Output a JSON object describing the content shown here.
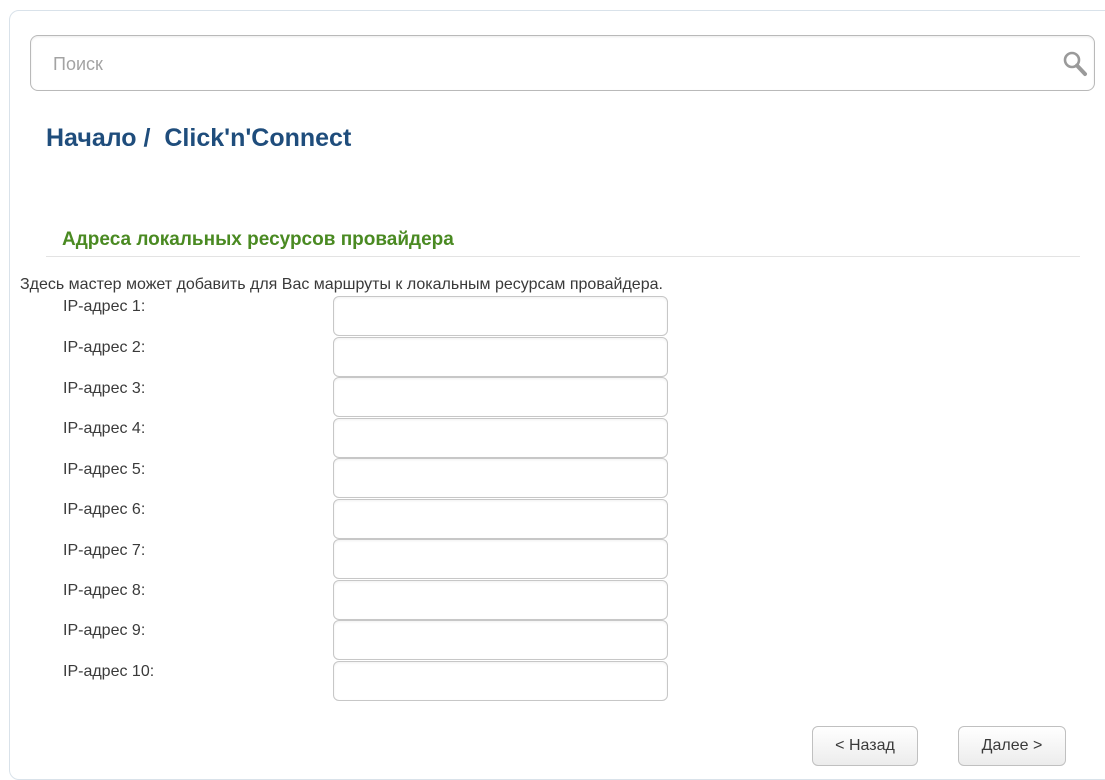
{
  "search": {
    "placeholder": "Поиск",
    "value": "",
    "icon": "search-icon"
  },
  "breadcrumb": {
    "root": "Начало",
    "separator": " /  ",
    "current": "Click'n'Connect"
  },
  "section": {
    "title": "Адреса локальных ресурсов провайдера",
    "description": "Здесь мастер может добавить для Вас маршруты к локальным ресурсам провайдера."
  },
  "fields": [
    {
      "label": "IP-адрес 1:",
      "value": ""
    },
    {
      "label": "IP-адрес 2:",
      "value": ""
    },
    {
      "label": "IP-адрес 3:",
      "value": ""
    },
    {
      "label": "IP-адрес 4:",
      "value": ""
    },
    {
      "label": "IP-адрес 5:",
      "value": ""
    },
    {
      "label": "IP-адрес 6:",
      "value": ""
    },
    {
      "label": "IP-адрес 7:",
      "value": ""
    },
    {
      "label": "IP-адрес 8:",
      "value": ""
    },
    {
      "label": "IP-адрес 9:",
      "value": ""
    },
    {
      "label": "IP-адрес 10:",
      "value": ""
    }
  ],
  "buttons": {
    "back": "< Назад",
    "next": "Далее >"
  },
  "colors": {
    "breadcrumb": "#1f4d7c",
    "section_title": "#4a8a22"
  }
}
